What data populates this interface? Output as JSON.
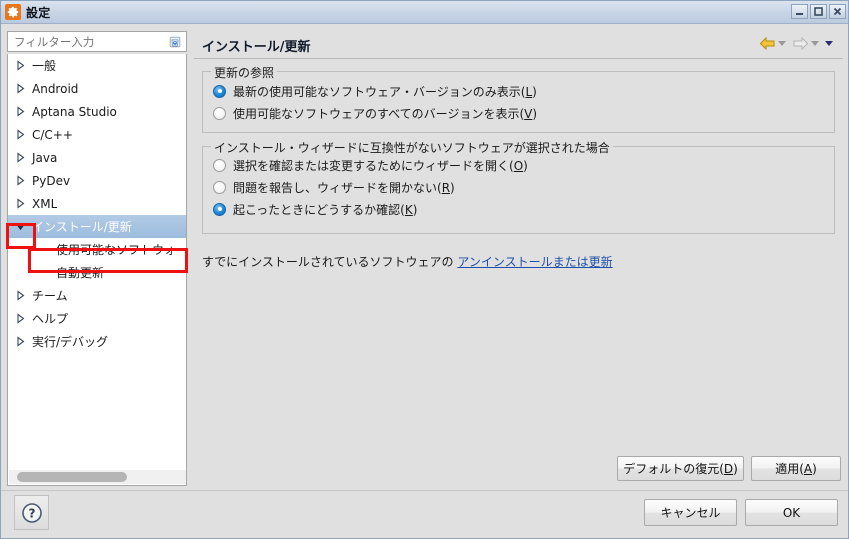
{
  "window": {
    "title": "設定",
    "icon": "gear-icon",
    "controls": {
      "minimize": "–",
      "maximize": "□",
      "close": "✕"
    }
  },
  "sidebar": {
    "filter": {
      "placeholder": "フィルター入力",
      "value": "",
      "clear_icon": "clear-filter-icon"
    },
    "items": [
      {
        "label": "一般",
        "expandable": true,
        "expanded": false,
        "selected": false,
        "child": false
      },
      {
        "label": "Android",
        "expandable": true,
        "expanded": false,
        "selected": false,
        "child": false
      },
      {
        "label": "Aptana Studio",
        "expandable": true,
        "expanded": false,
        "selected": false,
        "child": false
      },
      {
        "label": "C/C++",
        "expandable": true,
        "expanded": false,
        "selected": false,
        "child": false
      },
      {
        "label": "Java",
        "expandable": true,
        "expanded": false,
        "selected": false,
        "child": false
      },
      {
        "label": "PyDev",
        "expandable": true,
        "expanded": false,
        "selected": false,
        "child": false
      },
      {
        "label": "XML",
        "expandable": true,
        "expanded": false,
        "selected": false,
        "child": false
      },
      {
        "label": "インストール/更新",
        "expandable": true,
        "expanded": true,
        "selected": true,
        "child": false
      },
      {
        "label": "使用可能なソフトウォ",
        "expandable": false,
        "expanded": false,
        "selected": false,
        "child": true
      },
      {
        "label": "自動更新",
        "expandable": false,
        "expanded": false,
        "selected": false,
        "child": true
      },
      {
        "label": "チーム",
        "expandable": true,
        "expanded": false,
        "selected": false,
        "child": false
      },
      {
        "label": "ヘルプ",
        "expandable": true,
        "expanded": false,
        "selected": false,
        "child": false
      },
      {
        "label": "実行/デバッグ",
        "expandable": true,
        "expanded": false,
        "selected": false,
        "child": false
      }
    ]
  },
  "content": {
    "title": "インストール/更新",
    "nav": {
      "back": "back-arrow-icon",
      "forward": "forward-arrow-icon",
      "menu": "dropdown-arrow-icon"
    },
    "group1": {
      "title": "更新の参照",
      "options": [
        {
          "label": "最新の使用可能なソフトウェア・バージョンのみ表示(",
          "mnemonic": "L",
          "suffix": ")",
          "checked": true
        },
        {
          "label": "使用可能なソフトウェアのすべてのバージョンを表示(",
          "mnemonic": "V",
          "suffix": ")",
          "checked": false
        }
      ]
    },
    "group2": {
      "title": "インストール・ウィザードに互換性がないソフトウェアが選択された場合",
      "options": [
        {
          "label": "選択を確認または変更するためにウィザードを開く(",
          "mnemonic": "O",
          "suffix": ")",
          "checked": false
        },
        {
          "label": "問題を報告し、ウィザードを開かない(",
          "mnemonic": "R",
          "suffix": ")",
          "checked": false
        },
        {
          "label": "起こったときにどうするか確認(",
          "mnemonic": "K",
          "suffix": ")",
          "checked": true
        }
      ]
    },
    "already_installed": {
      "prefix": "すでにインストールされているソフトウェアの ",
      "link": "アンインストールまたは更新"
    },
    "restore_defaults": {
      "label": "デフォルトの復元(",
      "mnemonic": "D",
      "suffix": ")"
    },
    "apply": {
      "label": "適用(",
      "mnemonic": "A",
      "suffix": ")"
    }
  },
  "footer": {
    "help": "?",
    "cancel": "キャンセル",
    "ok": "OK"
  },
  "colors": {
    "accent_selected": "#9dbcdd",
    "link": "#1f4fa8",
    "annotation": "#ee1111",
    "title_icon_bg": "#e8761b"
  }
}
